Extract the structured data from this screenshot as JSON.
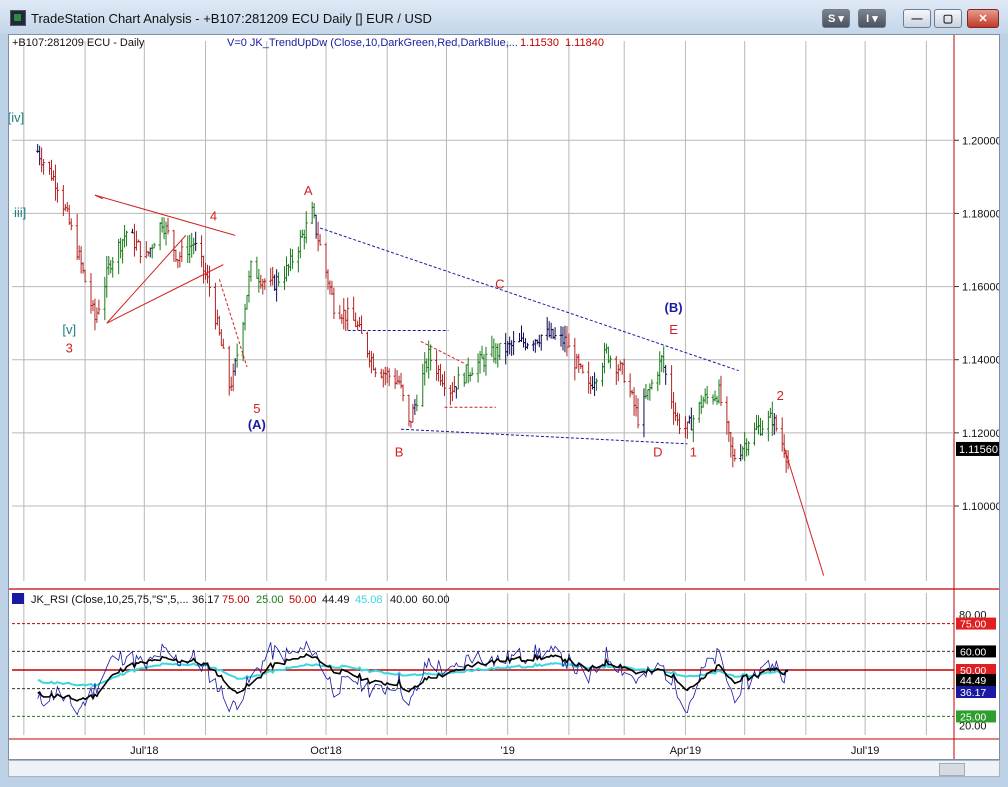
{
  "window": {
    "title": "TradeStation Chart Analysis - +B107:281209 ECU Daily [] EUR / USD"
  },
  "toolbar": {
    "s_label": "S ▾",
    "i_label": "I ▾",
    "min_icon": "minimize-icon",
    "max_icon": "maximize-icon",
    "close_icon": "close-icon"
  },
  "colors": {
    "up_bar": "#1a7a1a",
    "down_bar": "#b22222",
    "neutral_bar": "#0a0a50",
    "wave_red": "#d42020",
    "wave_blue": "#1a1aa0",
    "wave_teal": "#1a8080",
    "rsi_blue": "#1a1aa0",
    "rsi_cyan": "#3bd6e0"
  },
  "chart_data": [
    {
      "type": "line",
      "title": "",
      "symbol_label": "+B107:281209 ECU - Daily",
      "indicator_label": "V=0  JK_TrendUpDw  (Close,10,DarkGreen,Red,DarkBlue,...",
      "indicator_values": [
        "1.11530",
        "1.11840"
      ],
      "x_tick_labels": [
        "Jul'18",
        "Oct'18",
        "'19",
        "Apr'19",
        "Jul'19"
      ],
      "y_tick_labels": [
        "1.20000",
        "1.18000",
        "1.16000",
        "1.14000",
        "1.12000",
        "1.10000"
      ],
      "ylim": [
        1.0795,
        1.2255
      ],
      "last_price_label": "1.11560",
      "x": [
        "2018-05-08",
        "2018-05-18",
        "2018-05-28",
        "2018-06-06",
        "2018-06-14",
        "2018-06-22",
        "2018-07-02",
        "2018-07-10",
        "2018-07-18",
        "2018-07-26",
        "2018-08-03",
        "2018-08-13",
        "2018-08-15",
        "2018-08-24",
        "2018-09-03",
        "2018-09-12",
        "2018-09-24",
        "2018-10-05",
        "2018-10-16",
        "2018-10-26",
        "2018-11-07",
        "2018-11-12",
        "2018-11-22",
        "2018-12-03",
        "2018-12-14",
        "2018-12-26",
        "2019-01-10",
        "2019-01-20",
        "2019-01-30",
        "2019-02-11",
        "2019-02-20",
        "2019-03-01",
        "2019-03-08",
        "2019-03-20",
        "2019-03-28",
        "2019-04-02",
        "2019-04-10",
        "2019-04-18",
        "2019-04-25",
        "2019-05-07",
        "2019-05-15",
        "2019-05-21",
        "2019-06-10"
      ],
      "series": [
        {
          "values": [
            1.197,
            1.188,
            1.17,
            1.151,
            1.167,
            1.175,
            1.168,
            1.178,
            1.168,
            1.172,
            1.16,
            1.133,
            1.135,
            1.165,
            1.16,
            1.165,
            1.18,
            1.155,
            1.15,
            1.138,
            1.134,
            1.122,
            1.141,
            1.132,
            1.138,
            1.142,
            1.145,
            1.147,
            1.145,
            1.132,
            1.142,
            1.136,
            1.124,
            1.14,
            1.123,
            1.121,
            1.129,
            1.131,
            1.113,
            1.121,
            1.124,
            1.116,
            1.081
          ]
        }
      ],
      "wave_labels": [
        {
          "text": "[iv]",
          "color": "teal"
        },
        {
          "text": "[v]",
          "color": "teal"
        },
        {
          "text": "3",
          "color": "red"
        },
        {
          "text": "4",
          "color": "red"
        },
        {
          "text": "5",
          "color": "red"
        },
        {
          "text": "(A)",
          "color": "blue"
        },
        {
          "text": "A",
          "color": "red"
        },
        {
          "text": "B",
          "color": "red"
        },
        {
          "text": "C",
          "color": "red"
        },
        {
          "text": "(B)",
          "color": "blue"
        },
        {
          "text": "E",
          "color": "red"
        },
        {
          "text": "D",
          "color": "red"
        },
        {
          "text": "1",
          "color": "red"
        },
        {
          "text": "2",
          "color": "red"
        },
        {
          "text": "iii]",
          "color": "teal"
        }
      ]
    },
    {
      "type": "line",
      "title": "",
      "indicator_label": "JK_RSI (Close,10,25,75,\"S\",5,...",
      "indicator_values": [
        "36.17",
        "75.00",
        "25.00",
        "50.00",
        "44.49",
        "45.08",
        "40.00",
        "60.00"
      ],
      "y_tick_labels": [
        "80.00",
        "20.00"
      ],
      "ylim": [
        15,
        85
      ],
      "levels": [
        75,
        60,
        50,
        40,
        25
      ],
      "level_labels": [
        "75.00",
        "60.00",
        "50.00",
        "44.49",
        "36.17",
        "25.00"
      ],
      "series": [
        {
          "name": "RSI",
          "values": [
            33,
            38,
            28,
            40,
            55,
            58,
            52,
            60,
            55,
            57,
            48,
            32,
            30,
            45,
            60,
            58,
            62,
            40,
            45,
            38,
            44,
            30,
            55,
            48,
            58,
            55,
            58,
            60,
            56,
            45,
            58,
            50,
            44,
            52,
            40,
            30,
            50,
            58,
            36,
            48,
            54,
            48,
            36
          ]
        },
        {
          "name": "RSI smooth",
          "values": [
            37,
            36,
            34,
            36,
            46,
            52,
            54,
            56,
            55,
            55,
            52,
            42,
            38,
            42,
            52,
            55,
            58,
            50,
            47,
            43,
            43,
            38,
            46,
            48,
            53,
            55,
            56,
            57,
            56,
            50,
            54,
            52,
            48,
            50,
            45,
            40,
            45,
            52,
            44,
            47,
            51,
            49,
            44
          ]
        },
        {
          "name": "RSI signal",
          "values": [
            44,
            43,
            42,
            42,
            45,
            49,
            51,
            53,
            53,
            53,
            52,
            48,
            46,
            46,
            49,
            51,
            53,
            52,
            51,
            49,
            48,
            47,
            48,
            48,
            50,
            51,
            52,
            53,
            53,
            51,
            52,
            52,
            50,
            50,
            48,
            47,
            47,
            49,
            47,
            47,
            49,
            49,
            47
          ]
        }
      ]
    }
  ]
}
